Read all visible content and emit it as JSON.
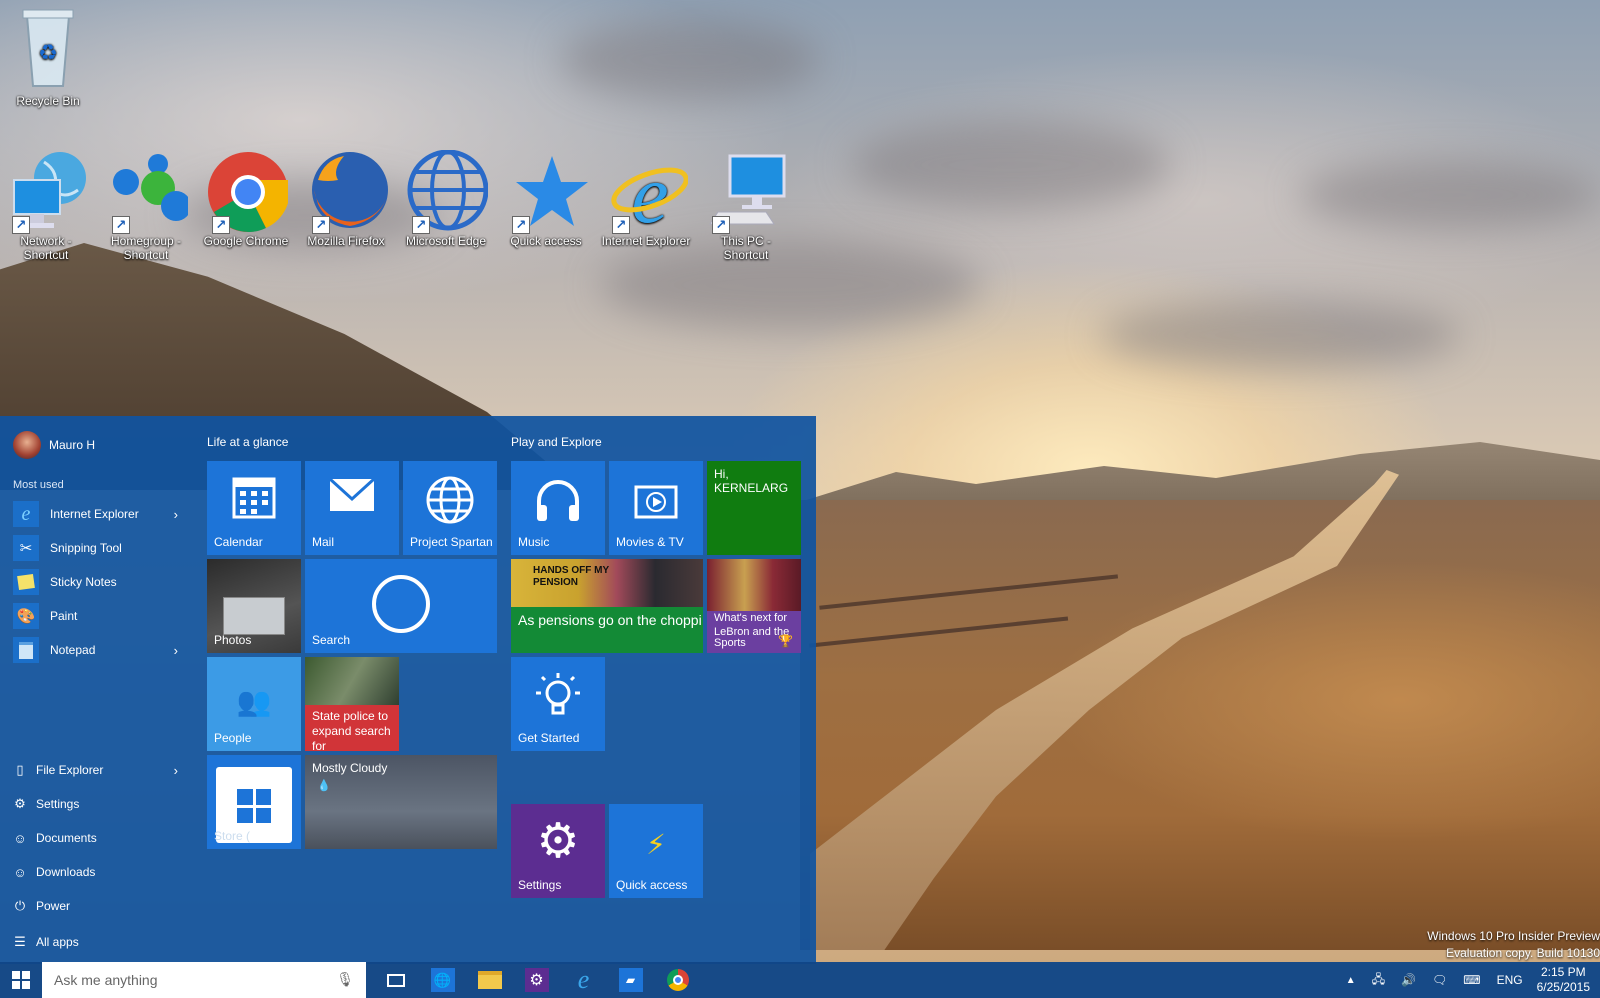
{
  "desktop": {
    "icons": [
      {
        "label": "Recycle Bin",
        "icon": "recycle-bin-icon"
      },
      {
        "label": "Network - Shortcut",
        "icon": "network-icon"
      },
      {
        "label": "Homegroup - Shortcut",
        "icon": "homegroup-icon"
      },
      {
        "label": "Google Chrome",
        "icon": "chrome-icon"
      },
      {
        "label": "Mozilla Firefox",
        "icon": "firefox-icon"
      },
      {
        "label": "Microsoft Edge",
        "icon": "globe-icon"
      },
      {
        "label": "Quick access",
        "icon": "star-icon"
      },
      {
        "label": "Internet Explorer",
        "icon": "internet-explorer-icon"
      },
      {
        "label": "This PC - Shortcut",
        "icon": "computer-icon"
      }
    ],
    "watermark": {
      "line1": "Windows 10 Pro Insider Preview",
      "line2": "Evaluation copy. Build 10130"
    }
  },
  "start_menu": {
    "user_name": "Mauro H",
    "most_used_label": "Most used",
    "most_used": [
      {
        "label": "Internet Explorer",
        "has_submenu": true
      },
      {
        "label": "Snipping Tool",
        "has_submenu": false
      },
      {
        "label": "Sticky Notes",
        "has_submenu": false
      },
      {
        "label": "Paint",
        "has_submenu": false
      },
      {
        "label": "Notepad",
        "has_submenu": true
      }
    ],
    "system_items": [
      {
        "label": "File Explorer",
        "has_submenu": true
      },
      {
        "label": "Settings"
      },
      {
        "label": "Documents"
      },
      {
        "label": "Downloads"
      },
      {
        "label": "Power"
      },
      {
        "label": "All apps"
      }
    ],
    "groups": [
      {
        "title": "Life at a glance"
      },
      {
        "title": "Play and Explore"
      }
    ],
    "tiles": {
      "calendar": "Calendar",
      "mail": "Mail",
      "project_spartan": "Project Spartan",
      "photos": "Photos",
      "search": "Search",
      "people": "People",
      "news": "State police to expand search for",
      "store": "Store (",
      "weather": "Mostly Cloudy",
      "music": "Music",
      "movies": "Movies & TV",
      "xbox": "Hi, KERNELARG",
      "money": "As pensions go on the choppi",
      "sports_headline": "What's next for LeBron and the Ca",
      "sports_label": "Sports",
      "get_started": "Get Started",
      "settings": "Settings",
      "quick_access": "Quick access",
      "pension_sign": "HANDS OFF MY PENSION"
    },
    "colors": {
      "accent": "#1d74d8",
      "money": "#138a36",
      "xbox": "#107c10",
      "settings": "#5c2d91",
      "news": "#d13438",
      "sports": "#6b3fa0"
    }
  },
  "taskbar": {
    "search_placeholder": "Ask me anything",
    "pinned": [
      "task-view-icon",
      "edge-icon",
      "file-explorer-icon",
      "settings-icon",
      "internet-explorer-icon",
      "store-icon",
      "chrome-icon"
    ],
    "language": "ENG",
    "time": "2:15 PM",
    "date": "6/25/2015"
  }
}
